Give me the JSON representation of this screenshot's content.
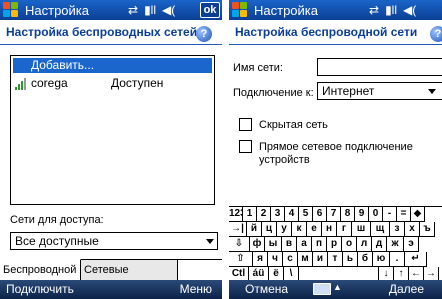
{
  "screen_left": {
    "titlebar": {
      "title": "Настройка",
      "ok_label": "ok"
    },
    "header": {
      "title": "Настройка беспроводных сетей"
    },
    "networks": {
      "add_label": "Добавить...",
      "items": [
        {
          "name": "corega",
          "status": "Доступен"
        }
      ]
    },
    "access": {
      "label": "Сети для доступа:",
      "value": "Все доступные"
    },
    "tabs": [
      {
        "label": "Беспроводной"
      },
      {
        "label": "Сетевые адаптеры"
      }
    ],
    "softkeys": {
      "left": "Подключить",
      "right": "Меню"
    }
  },
  "screen_right": {
    "titlebar": {
      "title": "Настройка"
    },
    "header": {
      "title": "Настройка беспроводной сети"
    },
    "form": {
      "network_name_label": "Имя сети:",
      "network_name_value": "",
      "connect_to_label": "Подключение к:",
      "connect_to_value": "Интернет",
      "hidden_network_label": "Скрытая сеть",
      "hidden_network_checked": false,
      "direct_connection_label_line1": "Прямое сетевое подключение",
      "direct_connection_label_line2": "устройств",
      "direct_connection_checked": false
    },
    "keyboard": {
      "rows": [
        [
          "123",
          "1",
          "2",
          "3",
          "4",
          "5",
          "6",
          "7",
          "8",
          "9",
          "0",
          "-",
          "=",
          "◆"
        ],
        [
          "→|",
          "й",
          "ц",
          "у",
          "к",
          "е",
          "н",
          "г",
          "ш",
          "щ",
          "з",
          "х",
          "ъ"
        ],
        [
          "⇩",
          "ф",
          "ы",
          "в",
          "а",
          "п",
          "р",
          "о",
          "л",
          "д",
          "ж",
          "э"
        ],
        [
          "⇧",
          "я",
          "ч",
          "с",
          "м",
          "и",
          "т",
          "ь",
          "б",
          "ю",
          ".",
          "↵"
        ],
        [
          "Ctl",
          "áü",
          "ё",
          "\\",
          "",
          "↓",
          "↑",
          "←",
          "→"
        ]
      ]
    },
    "softkeys": {
      "left": "Отмена",
      "right": "Далее"
    }
  }
}
